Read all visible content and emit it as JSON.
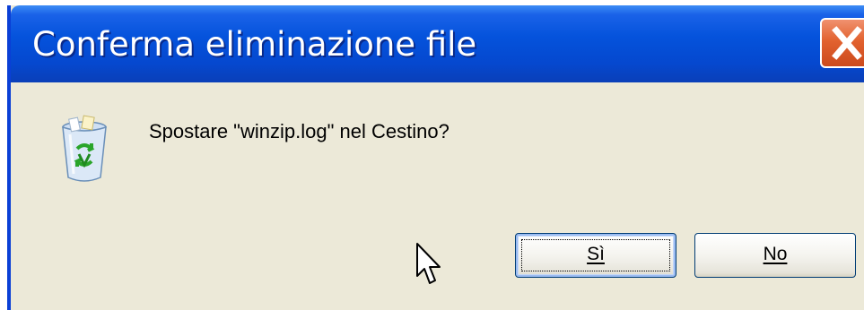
{
  "window": {
    "title": "Conferma eliminazione file"
  },
  "dialog": {
    "icon": "recycle-bin-icon",
    "message": "Spostare \"winzip.log\" nel Cestino?"
  },
  "buttons": {
    "yes_label": "Sì",
    "no_label": "No"
  },
  "colors": {
    "titlebar": "#0553dc",
    "close": "#e2622f",
    "body": "#ece9d8"
  }
}
